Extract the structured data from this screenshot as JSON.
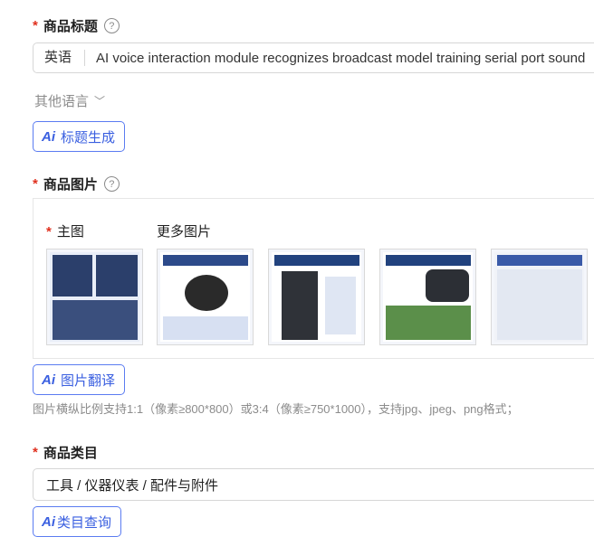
{
  "product_title": {
    "label": "商品标题",
    "help": "?",
    "lang_prefix": "英语",
    "value": "AI voice interaction module recognizes broadcast model training serial port sound"
  },
  "other_languages": {
    "label": "其他语言",
    "chevron": "﹀"
  },
  "title_generate_button": {
    "icon": "Ai",
    "label": "标题生成"
  },
  "product_images": {
    "label": "商品图片",
    "help": "?",
    "main_image_label": "主图",
    "more_images_label": "更多图片",
    "thumbnails": [
      "main-image",
      "more-image-1",
      "more-image-2",
      "more-image-3",
      "more-image-4"
    ]
  },
  "image_translate_button": {
    "icon": "Ai",
    "label": "图片翻译"
  },
  "image_hint": "图片横纵比例支持1:1（像素≥800*800）或3:4（像素≥750*1000），支持jpg、jpeg、png格式；",
  "product_category": {
    "label": "商品类目",
    "value": "工具 / 仪器仪表 / 配件与附件"
  },
  "category_query_button": {
    "icon": "Ai",
    "label": "类目查询"
  }
}
